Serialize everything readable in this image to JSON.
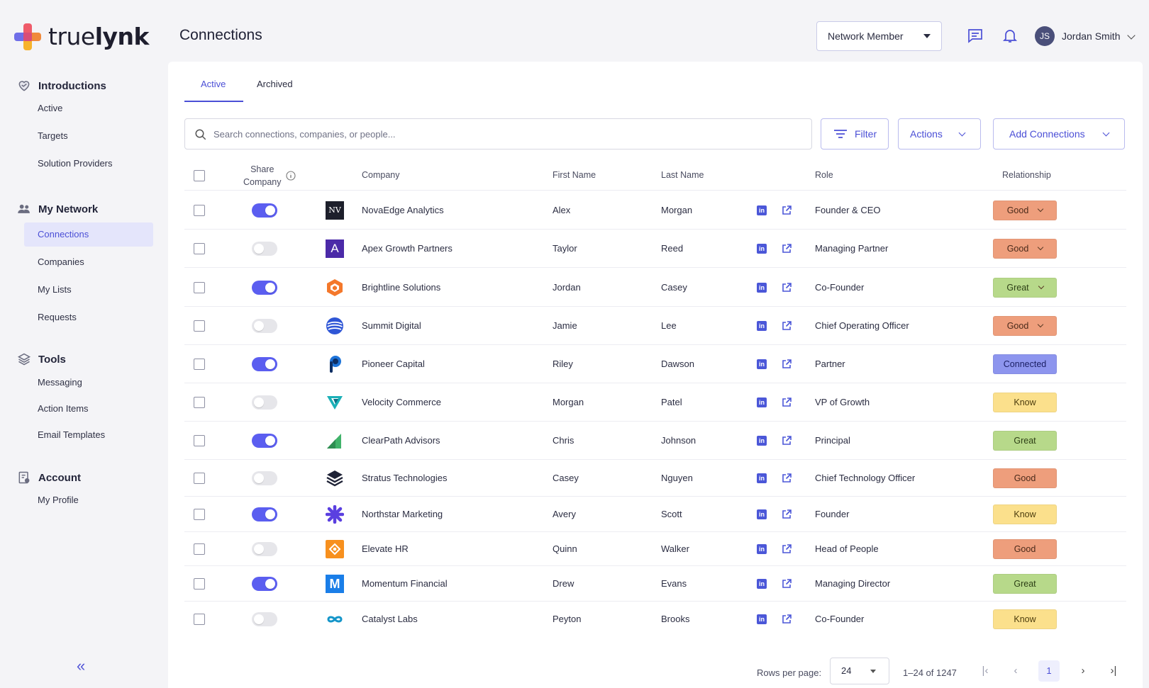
{
  "brand": {
    "name_light": "true",
    "name_bold": "lynk"
  },
  "sidebar": {
    "sections": [
      {
        "id": "introductions",
        "title": "Introductions",
        "icon": "heart-handshake-icon",
        "items": [
          "Active",
          "Targets",
          "Solution Providers"
        ]
      },
      {
        "id": "network",
        "title": "My Network",
        "icon": "people-icon",
        "items": [
          "Connections",
          "Companies",
          "My Lists",
          "Requests"
        ]
      },
      {
        "id": "tools",
        "title": "Tools",
        "icon": "layers-icon",
        "items": [
          "Messaging",
          "Action Items",
          "Email Templates"
        ]
      },
      {
        "id": "account",
        "title": "Account",
        "icon": "account-icon",
        "items": [
          "My Profile"
        ]
      }
    ],
    "active_item": "Connections",
    "collapse_label": "«"
  },
  "header": {
    "title": "Connections",
    "role_select": "Network Member",
    "user_initials": "JS",
    "user_name": "Jordan Smith"
  },
  "tabs": [
    {
      "label": "Active",
      "active": true
    },
    {
      "label": "Archived",
      "active": false
    }
  ],
  "toolbar": {
    "search_placeholder": "Search connections, companies, or people...",
    "filter_label": "Filter",
    "actions_label": "Actions",
    "add_label": "Add Connections"
  },
  "table": {
    "headers": {
      "share_line1": "Share",
      "share_line2": "Company",
      "company": "Company",
      "first_name": "First Name",
      "last_name": "Last Name",
      "role": "Role",
      "relationship": "Relationship"
    },
    "rows": [
      {
        "share": true,
        "company": "NovaEdge Analytics",
        "logo": "nv",
        "first": "Alex",
        "last": "Morgan",
        "role": "Founder & CEO",
        "relationship": "Good",
        "dropdown": true
      },
      {
        "share": false,
        "company": "Apex Growth Partners",
        "logo": "apex",
        "first": "Taylor",
        "last": "Reed",
        "role": "Managing Partner",
        "relationship": "Good",
        "dropdown": true
      },
      {
        "share": true,
        "company": "Brightline Solutions",
        "logo": "brightline",
        "first": "Jordan",
        "last": "Casey",
        "role": "Co-Founder",
        "relationship": "Great",
        "dropdown": true
      },
      {
        "share": false,
        "company": "Summit Digital",
        "logo": "summit",
        "first": "Jamie",
        "last": "Lee",
        "role": "Chief Operating Officer",
        "relationship": "Good",
        "dropdown": true
      },
      {
        "share": true,
        "company": "Pioneer Capital",
        "logo": "pioneer",
        "first": "Riley",
        "last": "Dawson",
        "role": "Partner",
        "relationship": "Connected",
        "dropdown": false
      },
      {
        "share": false,
        "company": "Velocity Commerce",
        "logo": "velocity",
        "first": "Morgan",
        "last": "Patel",
        "role": "VP of Growth",
        "relationship": "Know",
        "dropdown": false
      },
      {
        "share": true,
        "company": "ClearPath Advisors",
        "logo": "clearpath",
        "first": "Chris",
        "last": "Johnson",
        "role": "Principal",
        "relationship": "Great",
        "dropdown": false
      },
      {
        "share": false,
        "company": "Stratus Technologies",
        "logo": "stratus",
        "first": "Casey",
        "last": "Nguyen",
        "role": "Chief Technology Officer",
        "relationship": "Good",
        "dropdown": false
      },
      {
        "share": true,
        "company": "Northstar Marketing",
        "logo": "northstar",
        "first": "Avery",
        "last": "Scott",
        "role": "Founder",
        "relationship": "Know",
        "dropdown": false
      },
      {
        "share": false,
        "company": "Elevate HR",
        "logo": "elevate",
        "first": "Quinn",
        "last": "Walker",
        "role": "Head of People",
        "relationship": "Good",
        "dropdown": false
      },
      {
        "share": true,
        "company": "Momentum Financial",
        "logo": "momentum",
        "first": "Drew",
        "last": "Evans",
        "role": "Managing Director",
        "relationship": "Great",
        "dropdown": false
      },
      {
        "share": false,
        "company": "Catalyst Labs",
        "logo": "catalyst",
        "first": "Peyton",
        "last": "Brooks",
        "role": "Co-Founder",
        "relationship": "Know",
        "dropdown": false
      }
    ]
  },
  "relationship_colors": {
    "Good": {
      "bg": "#ee9e7c",
      "fg": "#4a2a1a"
    },
    "Great": {
      "bg": "#b7d98a",
      "fg": "#2d3f16"
    },
    "Know": {
      "bg": "#fbe08c",
      "fg": "#4d3d0e"
    },
    "Connected": {
      "bg": "#8d95ee",
      "fg": "#1c2065"
    }
  },
  "pagination": {
    "rows_label": "Rows per page:",
    "rows_value": "24",
    "range": "1–24 of 1247",
    "current_page": "1"
  },
  "colors": {
    "accent": "#4b4fd6",
    "toggle_on": "#5b5ef0"
  }
}
